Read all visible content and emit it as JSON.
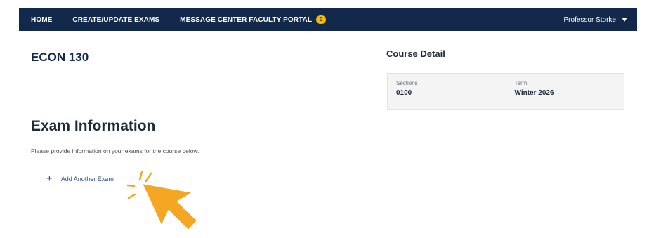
{
  "nav": {
    "items": [
      {
        "label": "HOME"
      },
      {
        "label": "CREATE/UPDATE EXAMS"
      },
      {
        "label": "MESSAGE CENTER FACULTY PORTAL",
        "badge": "0"
      }
    ],
    "user": "Professor Storke"
  },
  "course": {
    "code": "ECON 130"
  },
  "detail": {
    "title": "Course Detail",
    "sections_label": "Sections",
    "sections_value": "0100",
    "term_label": "Term",
    "term_value": "Winter 2026"
  },
  "exam": {
    "title": "Exam Information",
    "instructions": "Please provide information on your exams for the course below.",
    "add_label": "Add Another Exam"
  },
  "colors": {
    "nav_bg": "#13294b",
    "badge": "#f5b800",
    "link": "#2a4f8a",
    "pointer": "#f5a623"
  },
  "icons": {
    "plus": "plus-icon",
    "caret": "caret-down-icon",
    "pointer": "cursor-pointer-icon"
  }
}
